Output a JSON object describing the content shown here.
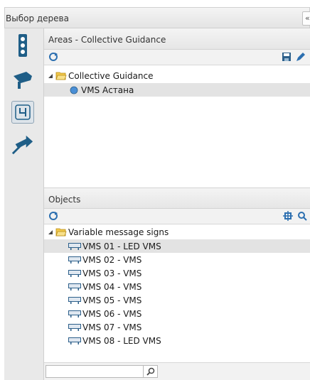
{
  "window": {
    "title": "Выбор дерева",
    "collapse_glyph": "«"
  },
  "toolbar": {
    "items": [
      {
        "icon": "traffic-light-icon"
      },
      {
        "icon": "camera-icon"
      },
      {
        "icon": "lane-sign-icon",
        "selected": true
      },
      {
        "icon": "direction-sign-icon"
      }
    ]
  },
  "areas": {
    "title": "Areas - Collective Guidance",
    "tree": {
      "root_label": "Collective Guidance",
      "children": [
        {
          "label": "VMS Астана",
          "selected": true
        }
      ]
    }
  },
  "objects": {
    "title": "Objects",
    "tree": {
      "root_label": "Variable message signs",
      "children": [
        {
          "label": "VMS 01 - LED VMS",
          "selected": true
        },
        {
          "label": "VMS 02 - VMS"
        },
        {
          "label": "VMS 03 - VMS"
        },
        {
          "label": "VMS 04 - VMS"
        },
        {
          "label": "VMS 05 - VMS"
        },
        {
          "label": "VMS 06 - VMS"
        },
        {
          "label": "VMS 07 - VMS"
        },
        {
          "label": "VMS 08 - LED VMS"
        }
      ]
    },
    "search": {
      "value": "",
      "placeholder": ""
    }
  },
  "colors": {
    "accent": "#2c6fb0",
    "selection": "#e3e3e3",
    "folder": "#f2c94c",
    "toolbar_icon": "#1f5e87"
  }
}
